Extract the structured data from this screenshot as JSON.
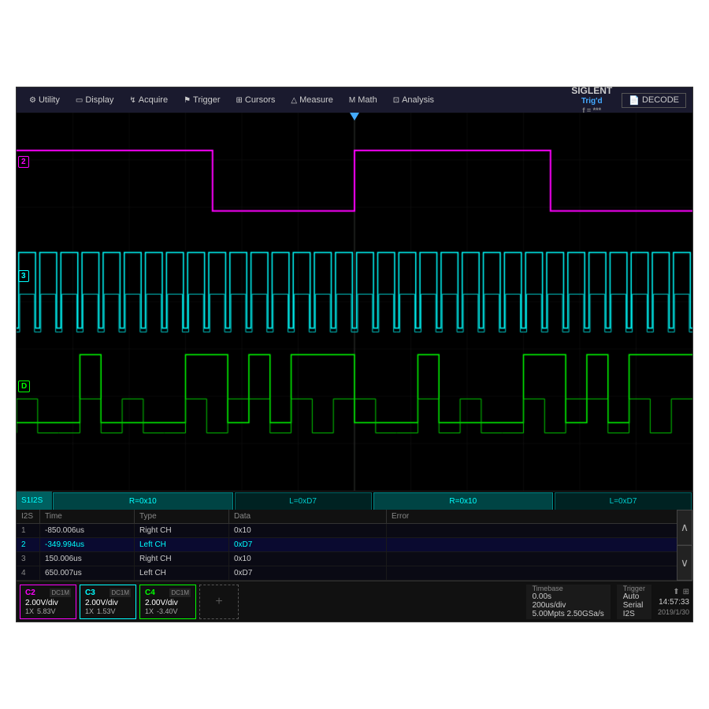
{
  "menu": {
    "items": [
      {
        "id": "utility",
        "icon": "⚙",
        "label": "Utility"
      },
      {
        "id": "display",
        "icon": "▭",
        "label": "Display"
      },
      {
        "id": "acquire",
        "icon": "↯",
        "label": "Acquire"
      },
      {
        "id": "trigger",
        "icon": "⚑",
        "label": "Trigger"
      },
      {
        "id": "cursors",
        "icon": "⊞",
        "label": "Cursors"
      },
      {
        "id": "measure",
        "icon": "△",
        "label": "Measure"
      },
      {
        "id": "math",
        "icon": "M",
        "label": "Math"
      },
      {
        "id": "analysis",
        "icon": "⊡",
        "label": "Analysis"
      }
    ],
    "brand": "SIGLENT",
    "trig_status": "Trig'd",
    "freq": "f = ***",
    "decode_label": "DECODE"
  },
  "decode_bar": {
    "label": "S1I2S",
    "segments": [
      {
        "text": "R=0x10",
        "flex": 2,
        "color": "#006666"
      },
      {
        "text": "L=0xD7",
        "flex": 1.5,
        "color": "#004444"
      },
      {
        "text": "R=0x10",
        "flex": 2,
        "color": "#006666"
      },
      {
        "text": "L=0xD7",
        "flex": 1.5,
        "color": "#004444"
      }
    ]
  },
  "table": {
    "header": [
      "I2S",
      "Time",
      "Type",
      "Data",
      "Error"
    ],
    "rows": [
      {
        "index": "1",
        "time": "-850.006us",
        "type": "Right CH",
        "type_color": "#ccc",
        "data": "0x10",
        "error": "",
        "active": false
      },
      {
        "index": "2",
        "time": "-349.994us",
        "type": "Left CH",
        "type_color": "#0ff",
        "data": "0xD7",
        "error": "",
        "active": true
      },
      {
        "index": "3",
        "time": "150.006us",
        "type": "Right CH",
        "type_color": "#ccc",
        "data": "0x10",
        "error": "",
        "active": false
      },
      {
        "index": "4",
        "time": "650.007us",
        "type": "Left CH",
        "type_color": "#ccc",
        "data": "0xD7",
        "error": "",
        "active": false
      }
    ]
  },
  "channels": [
    {
      "id": "C2",
      "label": "C2",
      "class": "ch2",
      "dc": "DC1M",
      "volts": "2.00V/div",
      "probe": "1X",
      "value": "5.83V"
    },
    {
      "id": "C3",
      "label": "C3",
      "class": "ch3",
      "dc": "DC1M",
      "volts": "2.00V/div",
      "probe": "1X",
      "value": "1.53V"
    },
    {
      "id": "C4",
      "label": "C4",
      "class": "ch4",
      "dc": "DC1M",
      "volts": "2.00V/div",
      "probe": "1X",
      "value": "-3.40V"
    }
  ],
  "timebase": {
    "label": "Timebase",
    "delay": "0.00s",
    "scale": "200us/div",
    "samples": "5.00Mpts",
    "srate": "2.50GSa/s"
  },
  "trigger": {
    "label": "Trigger",
    "mode": "Auto",
    "type": "Serial",
    "protocol": "I2S"
  },
  "clock": {
    "time": "14:57:33",
    "date": "2019/1/30"
  },
  "waveform": {
    "ch2_color": "#ff00ff",
    "ch3_color": "#00ffff",
    "ch4_color": "#00ff00",
    "grid_color": "#1a2a1a",
    "bg_color": "#000000"
  }
}
